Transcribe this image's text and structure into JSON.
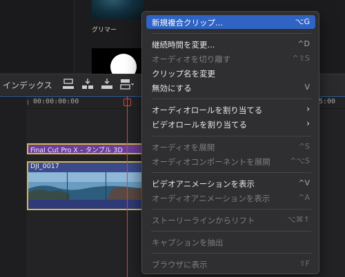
{
  "browser": {
    "glimmer_label": "グリマー"
  },
  "toolbar": {
    "index_label": "インデックス"
  },
  "timeline": {
    "timecode_start": "00:00:00:00",
    "timecode_end": "5:00",
    "title_clip_label": "Final Cut Pro X – タンブル 3D",
    "video_clip_label": "DJI_0017"
  },
  "menu": {
    "items": [
      {
        "label": "新規複合クリップ...",
        "shortcut": "⌥G",
        "enabled": true,
        "highlighted": true
      },
      {
        "label": "継続時間を変更...",
        "shortcut": "^D",
        "enabled": true
      },
      {
        "label": "オーディオを切り離す",
        "shortcut": "^⇧S",
        "enabled": false
      },
      {
        "label": "クリップ名を変更",
        "shortcut": "",
        "enabled": true
      },
      {
        "label": "無効にする",
        "shortcut": "V",
        "enabled": true
      },
      {
        "label": "オーディオロールを割り当てる",
        "shortcut": "",
        "enabled": true,
        "submenu": true
      },
      {
        "label": "ビデオロールを割り当てる",
        "shortcut": "",
        "enabled": true,
        "submenu": true
      },
      {
        "label": "オーディオを展開",
        "shortcut": "^S",
        "enabled": false
      },
      {
        "label": "オーディオコンポーネントを展開",
        "shortcut": "^⌥S",
        "enabled": false
      },
      {
        "label": "ビデオアニメーションを表示",
        "shortcut": "^V",
        "enabled": true
      },
      {
        "label": "オーディオアニメーションを表示",
        "shortcut": "^A",
        "enabled": false
      },
      {
        "label": "ストーリーラインからリフト",
        "shortcut": "⌥⌘↑",
        "enabled": false
      },
      {
        "label": "キャプションを抽出",
        "shortcut": "",
        "enabled": false
      },
      {
        "label": "ブラウザに表示",
        "shortcut": "⇧F",
        "enabled": false
      }
    ],
    "submenu_chevron": "›"
  }
}
